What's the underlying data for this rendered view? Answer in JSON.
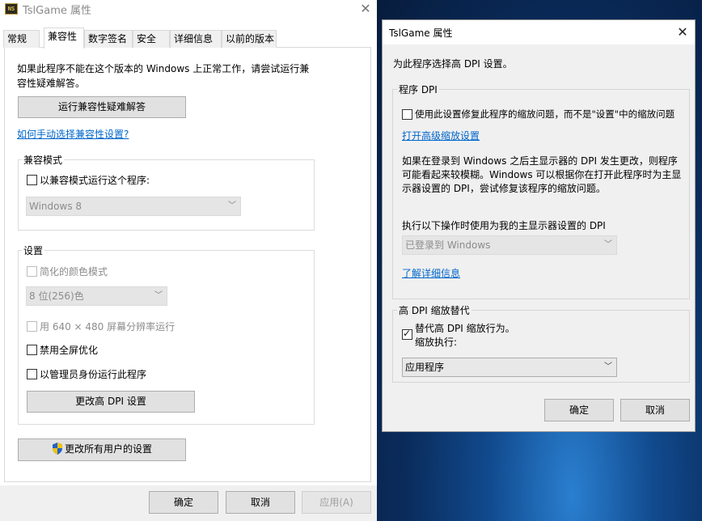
{
  "left_window": {
    "title": "TslGame 属性",
    "icon_text": "NS",
    "tabs": [
      "常规",
      "兼容性",
      "数字签名",
      "安全",
      "详细信息",
      "以前的版本"
    ],
    "intro": [
      "如果此程序不能在这个版本的 Windows 上正常工作，请尝试运行兼",
      "容性疑难解答。"
    ],
    "troubleshoot_button": "运行兼容性疑难解答",
    "manual_link": "如何手动选择兼容性设置?",
    "compat_mode": {
      "group_label": "兼容模式",
      "checkbox_label": "以兼容模式运行这个程序:",
      "os_select": "Windows 8"
    },
    "settings": {
      "group_label": "设置",
      "reduced_color_label": "简化的颜色模式",
      "color_select": "8 位(256)色",
      "resolution_label": "用 640 × 480 屏幕分辨率运行",
      "disable_fullscreen_label": "禁用全屏优化",
      "run_as_admin_label": "以管理员身份运行此程序",
      "dpi_button": "更改高 DPI 设置"
    },
    "all_users_button": "更改所有用户的设置",
    "footer": {
      "ok": "确定",
      "cancel": "取消",
      "apply": "应用(A)"
    }
  },
  "right_window": {
    "title": "TslGame 属性",
    "heading": "为此程序选择高 DPI 设置。",
    "program_dpi": {
      "group_label": "程序 DPI",
      "checkbox_label": "使用此设置修复此程序的缩放问题，而不是\"设置\"中的缩放问题",
      "advanced_link": "打开高级缩放设置",
      "description": [
        "如果在登录到 Windows 之后主显示器的 DPI 发生更改，则程序",
        "可能看起来较模糊。Windows 可以根据你在打开此程序时为主显",
        "示器设置的 DPI，尝试修复该程序的缩放问题。"
      ],
      "select_label": "执行以下操作时使用为我的主显示器设置的 DPI",
      "select_value": "已登录到 Windows",
      "learn_more": "了解详细信息"
    },
    "override": {
      "group_label": "高 DPI 缩放替代",
      "checkbox_label": "替代高 DPI 缩放行为。",
      "sub_label": "缩放执行:",
      "select_value": "应用程序"
    },
    "footer": {
      "ok": "确定",
      "cancel": "取消"
    }
  },
  "colors": {
    "link": "#0066cc",
    "dialog_bg": "#f0f0f0",
    "button_bg": "#e1e1e1"
  }
}
